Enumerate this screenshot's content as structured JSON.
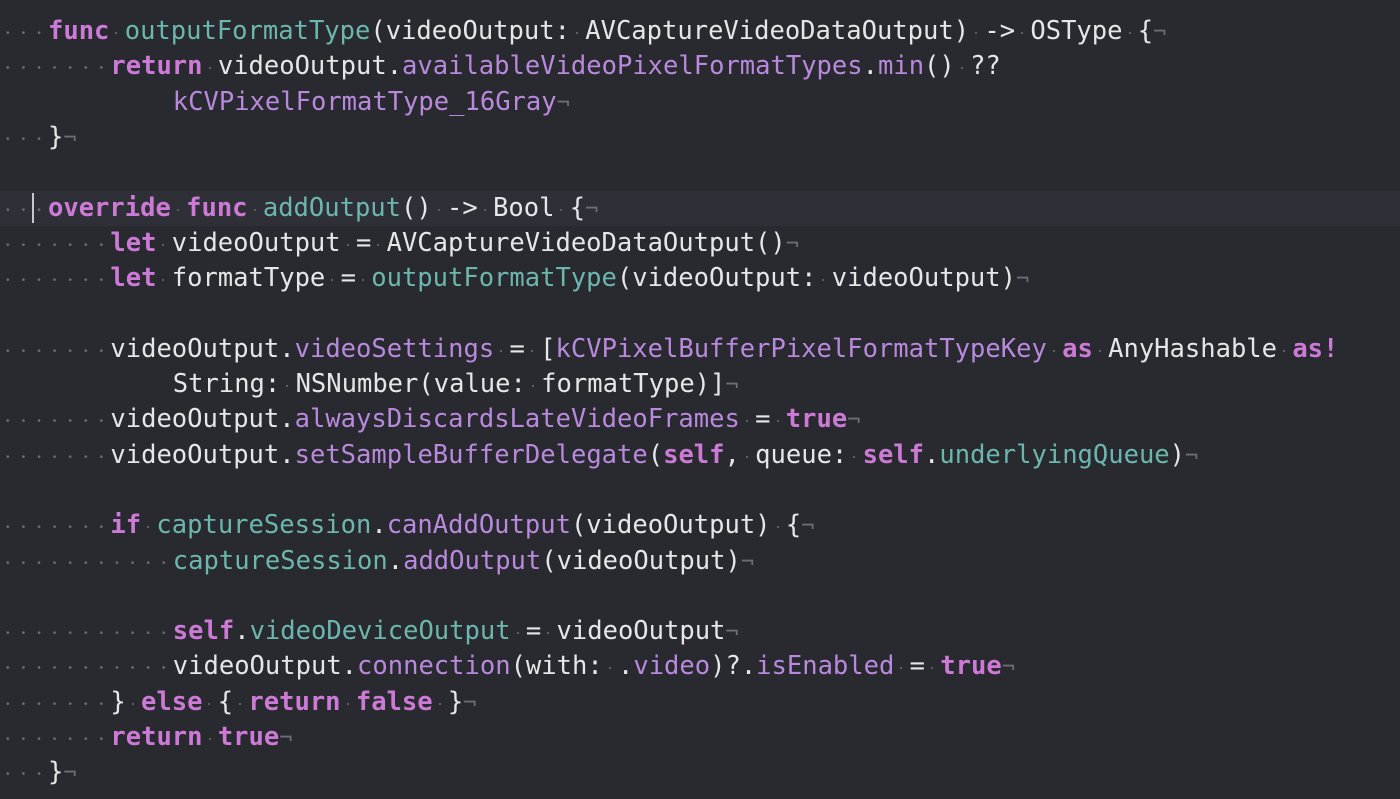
{
  "editor": {
    "language": "swift",
    "colors": {
      "background": "#292a30",
      "current_line": "#2f3037",
      "keyword": "#cd7ad6",
      "project_symbol": "#6cb7ad",
      "system_symbol": "#b889dc",
      "plain": "#e6e6e8",
      "invisibles": "#6c6d75"
    },
    "lines": [
      {
        "indent": 0,
        "tokens": [
          {
            "t": "func",
            "c": "kw"
          },
          {
            "t": " ",
            "c": "dot"
          },
          {
            "t": "outputFormatType",
            "c": "proj"
          },
          {
            "t": "(videoOutput:",
            "c": "plain"
          },
          {
            "t": " ",
            "c": "dot"
          },
          {
            "t": "AVCaptureVideoDataOutput)",
            "c": "plain"
          },
          {
            "t": " ",
            "c": "dot"
          },
          {
            "t": "->",
            "c": "plain"
          },
          {
            "t": " ",
            "c": "dot"
          },
          {
            "t": "OSType",
            "c": "plain"
          },
          {
            "t": " ",
            "c": "dot"
          },
          {
            "t": "{",
            "c": "plain"
          }
        ],
        "eol": true
      },
      {
        "indent": 4,
        "tokens": [
          {
            "t": "return",
            "c": "kw"
          },
          {
            "t": " ",
            "c": "dot"
          },
          {
            "t": "videoOutput.",
            "c": "plain"
          },
          {
            "t": "availableVideoPixelFormatTypes",
            "c": "sys"
          },
          {
            "t": ".",
            "c": "plain"
          },
          {
            "t": "min",
            "c": "sys"
          },
          {
            "t": "()",
            "c": "plain"
          },
          {
            "t": " ",
            "c": "dot"
          },
          {
            "t": "??",
            "c": "plain"
          }
        ],
        "eol": false
      },
      {
        "indent": 8,
        "wrap": true,
        "tokens": [
          {
            "t": "kCVPixelFormatType_16Gray",
            "c": "sys"
          }
        ],
        "eol": true
      },
      {
        "indent": 0,
        "tokens": [
          {
            "t": "}",
            "c": "plain"
          }
        ],
        "eol": true
      },
      {
        "indent": 0,
        "blank": true,
        "tokens": [],
        "eol": false
      },
      {
        "indent": 0,
        "current": true,
        "tokens": [
          {
            "t": "override",
            "c": "kw"
          },
          {
            "t": " ",
            "c": "dot"
          },
          {
            "t": "func",
            "c": "kw"
          },
          {
            "t": " ",
            "c": "dot"
          },
          {
            "t": "addOutput",
            "c": "proj"
          },
          {
            "t": "()",
            "c": "plain"
          },
          {
            "t": " ",
            "c": "dot"
          },
          {
            "t": "->",
            "c": "plain"
          },
          {
            "t": " ",
            "c": "dot"
          },
          {
            "t": "Bool",
            "c": "plain"
          },
          {
            "t": " ",
            "c": "dot"
          },
          {
            "t": "{",
            "c": "plain"
          }
        ],
        "eol": true
      },
      {
        "indent": 4,
        "tokens": [
          {
            "t": "let",
            "c": "kw"
          },
          {
            "t": " ",
            "c": "dot"
          },
          {
            "t": "videoOutput",
            "c": "plain"
          },
          {
            "t": " ",
            "c": "dot"
          },
          {
            "t": "=",
            "c": "plain"
          },
          {
            "t": " ",
            "c": "dot"
          },
          {
            "t": "AVCaptureVideoDataOutput()",
            "c": "plain"
          }
        ],
        "eol": true
      },
      {
        "indent": 4,
        "tokens": [
          {
            "t": "let",
            "c": "kw"
          },
          {
            "t": " ",
            "c": "dot"
          },
          {
            "t": "formatType",
            "c": "plain"
          },
          {
            "t": " ",
            "c": "dot"
          },
          {
            "t": "=",
            "c": "plain"
          },
          {
            "t": " ",
            "c": "dot"
          },
          {
            "t": "outputFormatType",
            "c": "proj"
          },
          {
            "t": "(videoOutput:",
            "c": "plain"
          },
          {
            "t": " ",
            "c": "dot"
          },
          {
            "t": "videoOutput)",
            "c": "plain"
          }
        ],
        "eol": true
      },
      {
        "indent": 0,
        "blank": true,
        "tokens": [],
        "eol": false
      },
      {
        "indent": 4,
        "tokens": [
          {
            "t": "videoOutput.",
            "c": "plain"
          },
          {
            "t": "videoSettings",
            "c": "sys"
          },
          {
            "t": " ",
            "c": "dot"
          },
          {
            "t": "=",
            "c": "plain"
          },
          {
            "t": " ",
            "c": "dot"
          },
          {
            "t": "[",
            "c": "plain"
          },
          {
            "t": "kCVPixelBufferPixelFormatTypeKey",
            "c": "sys"
          },
          {
            "t": " ",
            "c": "dot"
          },
          {
            "t": "as",
            "c": "kw"
          },
          {
            "t": " ",
            "c": "dot"
          },
          {
            "t": "AnyHashable",
            "c": "plain"
          },
          {
            "t": " ",
            "c": "dot"
          },
          {
            "t": "as!",
            "c": "kw"
          }
        ],
        "eol": false
      },
      {
        "indent": 8,
        "wrap": true,
        "tokens": [
          {
            "t": "String:",
            "c": "plain"
          },
          {
            "t": " ",
            "c": "dot"
          },
          {
            "t": "NSNumber(value:",
            "c": "plain"
          },
          {
            "t": " ",
            "c": "dot"
          },
          {
            "t": "formatType)]",
            "c": "plain"
          }
        ],
        "eol": true
      },
      {
        "indent": 4,
        "tokens": [
          {
            "t": "videoOutput.",
            "c": "plain"
          },
          {
            "t": "alwaysDiscardsLateVideoFrames",
            "c": "sys"
          },
          {
            "t": " ",
            "c": "dot"
          },
          {
            "t": "=",
            "c": "plain"
          },
          {
            "t": " ",
            "c": "dot"
          },
          {
            "t": "true",
            "c": "kw"
          }
        ],
        "eol": true
      },
      {
        "indent": 4,
        "tokens": [
          {
            "t": "videoOutput.",
            "c": "plain"
          },
          {
            "t": "setSampleBufferDelegate",
            "c": "sys"
          },
          {
            "t": "(",
            "c": "plain"
          },
          {
            "t": "self",
            "c": "kw"
          },
          {
            "t": ",",
            "c": "plain"
          },
          {
            "t": " ",
            "c": "dot"
          },
          {
            "t": "queue:",
            "c": "plain"
          },
          {
            "t": " ",
            "c": "dot"
          },
          {
            "t": "self",
            "c": "kw"
          },
          {
            "t": ".",
            "c": "plain"
          },
          {
            "t": "underlyingQueue",
            "c": "proj"
          },
          {
            "t": ")",
            "c": "plain"
          }
        ],
        "eol": true
      },
      {
        "indent": 0,
        "blank": true,
        "tokens": [],
        "eol": false
      },
      {
        "indent": 4,
        "tokens": [
          {
            "t": "if",
            "c": "kw"
          },
          {
            "t": " ",
            "c": "dot"
          },
          {
            "t": "captureSession",
            "c": "proj"
          },
          {
            "t": ".",
            "c": "plain"
          },
          {
            "t": "canAddOutput",
            "c": "sys"
          },
          {
            "t": "(videoOutput)",
            "c": "plain"
          },
          {
            "t": " ",
            "c": "dot"
          },
          {
            "t": "{",
            "c": "plain"
          }
        ],
        "eol": true
      },
      {
        "indent": 8,
        "tokens": [
          {
            "t": "captureSession",
            "c": "proj"
          },
          {
            "t": ".",
            "c": "plain"
          },
          {
            "t": "addOutput",
            "c": "sys"
          },
          {
            "t": "(videoOutput)",
            "c": "plain"
          }
        ],
        "eol": true
      },
      {
        "indent": 0,
        "blank": true,
        "tokens": [],
        "eol": false
      },
      {
        "indent": 8,
        "tokens": [
          {
            "t": "self",
            "c": "kw"
          },
          {
            "t": ".",
            "c": "plain"
          },
          {
            "t": "videoDeviceOutput",
            "c": "proj"
          },
          {
            "t": " ",
            "c": "dot"
          },
          {
            "t": "=",
            "c": "plain"
          },
          {
            "t": " ",
            "c": "dot"
          },
          {
            "t": "videoOutput",
            "c": "plain"
          }
        ],
        "eol": true
      },
      {
        "indent": 8,
        "tokens": [
          {
            "t": "videoOutput.",
            "c": "plain"
          },
          {
            "t": "connection",
            "c": "sys"
          },
          {
            "t": "(with:",
            "c": "plain"
          },
          {
            "t": " ",
            "c": "dot"
          },
          {
            "t": ".",
            "c": "plain"
          },
          {
            "t": "video",
            "c": "sys"
          },
          {
            "t": ")?.",
            "c": "plain"
          },
          {
            "t": "isEnabled",
            "c": "sys"
          },
          {
            "t": " ",
            "c": "dot"
          },
          {
            "t": "=",
            "c": "plain"
          },
          {
            "t": " ",
            "c": "dot"
          },
          {
            "t": "true",
            "c": "kw"
          }
        ],
        "eol": true
      },
      {
        "indent": 4,
        "tokens": [
          {
            "t": "}",
            "c": "plain"
          },
          {
            "t": " ",
            "c": "dot"
          },
          {
            "t": "else",
            "c": "kw"
          },
          {
            "t": " ",
            "c": "dot"
          },
          {
            "t": "{",
            "c": "plain"
          },
          {
            "t": " ",
            "c": "dot"
          },
          {
            "t": "return",
            "c": "kw"
          },
          {
            "t": " ",
            "c": "dot"
          },
          {
            "t": "false",
            "c": "kw"
          },
          {
            "t": " ",
            "c": "dot"
          },
          {
            "t": "}",
            "c": "plain"
          }
        ],
        "eol": true
      },
      {
        "indent": 4,
        "tokens": [
          {
            "t": "return",
            "c": "kw"
          },
          {
            "t": " ",
            "c": "dot"
          },
          {
            "t": "true",
            "c": "kw"
          }
        ],
        "eol": true
      },
      {
        "indent": 0,
        "tokens": [
          {
            "t": "}",
            "c": "plain"
          }
        ],
        "eol": true
      }
    ]
  }
}
